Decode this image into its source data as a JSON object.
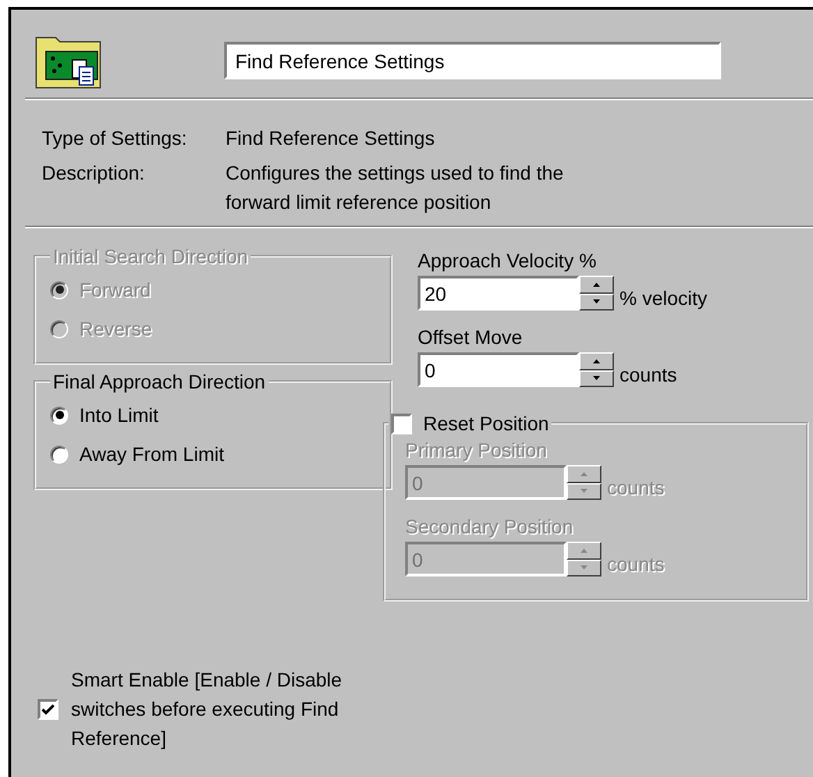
{
  "header": {
    "name_value": "Find Reference Settings"
  },
  "info": [
    {
      "label": "Type of Settings:",
      "value": "Find Reference Settings"
    },
    {
      "label": "Description:",
      "value": "Configures the settings used to find the forward limit reference position"
    }
  ],
  "radio_groups": [
    {
      "title": "Initial Search Direction",
      "disabled": true,
      "options": [
        {
          "label": "Forward",
          "selected": true
        },
        {
          "label": "Reverse",
          "selected": false
        }
      ]
    },
    {
      "title": "Final Approach Direction",
      "disabled": false,
      "options": [
        {
          "label": "Into Limit",
          "selected": true
        },
        {
          "label": "Away From Limit",
          "selected": false
        }
      ]
    }
  ],
  "spin_fields": [
    {
      "label": "Approach Velocity %",
      "value": "20",
      "unit": "% velocity",
      "disabled": false
    },
    {
      "label": "Offset Move",
      "value": "0",
      "unit": "counts",
      "disabled": false
    }
  ],
  "reset_group": {
    "label": "Reset Position",
    "checked": false,
    "fields": [
      {
        "label": "Primary Position",
        "value": "0",
        "unit": "counts",
        "disabled": true
      },
      {
        "label": "Secondary Position",
        "value": "0",
        "unit": "counts",
        "disabled": true
      }
    ]
  },
  "smart_enable": {
    "label": "Smart Enable [Enable / Disable switches before executing Find Reference]",
    "checked": true
  }
}
